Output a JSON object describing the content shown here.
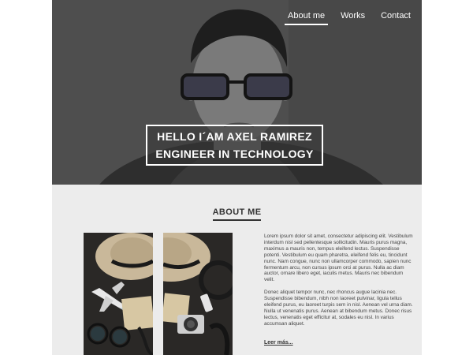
{
  "nav": {
    "items": [
      {
        "label": "About me",
        "active": true
      },
      {
        "label": "Works",
        "active": false
      },
      {
        "label": "Contact",
        "active": false
      }
    ]
  },
  "hero": {
    "line1": "HELLO I´AM AXEL RAMIREZ",
    "line2": "ENGINEER IN TECHNOLOGY"
  },
  "about": {
    "heading": "ABOUT ME",
    "paragraph1": "Lorem ipsum dolor sit amet, consectetur adipiscing elit. Vestibulum interdum nisl sed pellentesque sollicitudin. Mauris purus magna, maximus a mauris non, tempus eleifend lectus. Suspendisse potenti. Vestibulum eu quam pharetra, eleifend felis eu, tincidunt nunc. Nam congue, nunc non ullamcorper commodo, sapien nunc fermentum arcu, non cursus ipsum orci at purus. Nulla ac diam auctor, ornare libero eget, iaculis metus. Mauris nec bibendum velit.",
    "paragraph2": "Donec aliquet tempor nunc, nec rhoncus augue lacinia nec. Suspendisse bibendum, nibh non laoreet pulvinar, ligula tellus eleifend purus, eu laoreet turpis sem in nisl. Aenean vel urna diam. Nulla ut venenatis purus. Aenean at bibendum metus. Donec risus lectus, venenatis eget efficitur at, sodales eu nisl. In varius accumsan aliquet.",
    "read_more": "Leer más..."
  }
}
